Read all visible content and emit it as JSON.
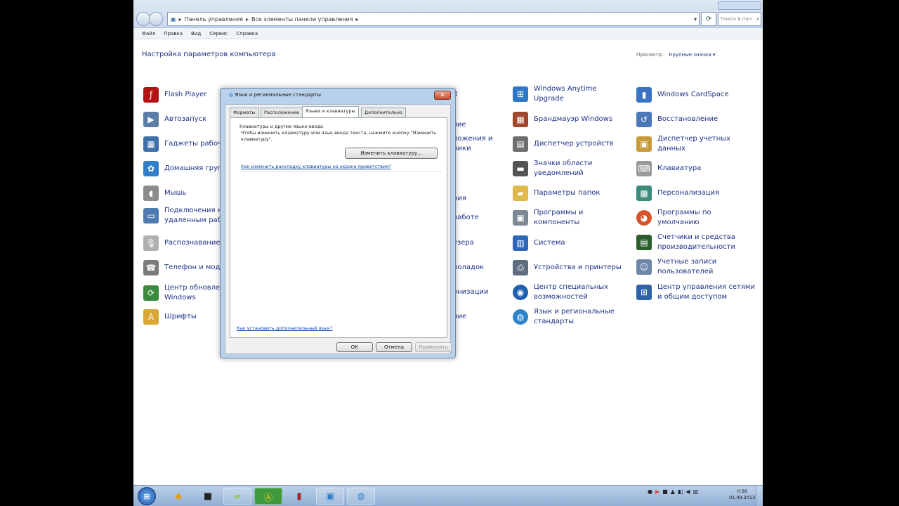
{
  "address": {
    "segments": [
      "Панель управления",
      "Все элементы панели управления"
    ],
    "search_placeholder": "Поиск в пан"
  },
  "menu": [
    "Файл",
    "Правка",
    "Вид",
    "Сервис",
    "Справка"
  ],
  "header": {
    "title": "Настройка параметров компьютера",
    "view_label": "Просмотр:",
    "view_value": "Крупные значки"
  },
  "items": {
    "col1": [
      "Flash Player",
      "Автозапуск",
      "Гаджеты рабоч",
      "Домашняя груп",
      "Мышь",
      "Подключения к\nудаленным раб",
      "Распознавание",
      "Телефон и моде",
      "Центр обновлен\nWindows",
      "Шрифты"
    ],
    "col2": [
      "X",
      "чие",
      "ложения и\nники",
      "ния",
      "работе",
      "узера",
      "лоладок",
      "онизации",
      "ние"
    ],
    "col3": [
      "Windows Anytime\nUpgrade",
      "Брандмауэр Windows",
      "Диспетчер устройств",
      "Значки области\nуведомлений",
      "Параметры папок",
      "Программы и\nкомпоненты",
      "Система",
      "Устройства и принтеры",
      "Центр специальных\nвозможностей",
      "Язык и региональные\nстандарты"
    ],
    "col4": [
      "Windows CardSpace",
      "Восстановление",
      "Диспетчер учетных\nданных",
      "Клавиатура",
      "Персонализация",
      "Программы по\nумолчанию",
      "Счетчики и средства\nпроизводительности",
      "Учетные записи\nпользователей",
      "Центр управления сетями\nи общим доступом"
    ]
  },
  "dialog": {
    "title": "Язык и региональные стандарты",
    "tabs": [
      "Форматы",
      "Расположение",
      "Языки и клавиатуры",
      "Дополнительно"
    ],
    "section_heading": "Клавиатуры и другие языки ввода",
    "description": "Чтобы изменить клавиатуру или язык ввода текста, нажмите кнопку \"Изменить клавиатуру\".",
    "change_keyboard_button": "Изменить клавиатуру...",
    "welcome_link": "Как изменить раскладку клавиатуры на экране приветствия?",
    "install_lang_link": "Как установить дополнительный язык?",
    "ok": "ОК",
    "cancel": "Отмена",
    "apply": "Применить"
  },
  "taskbar": {
    "clock_time": "0:58",
    "clock_date": "01.09.2013"
  }
}
